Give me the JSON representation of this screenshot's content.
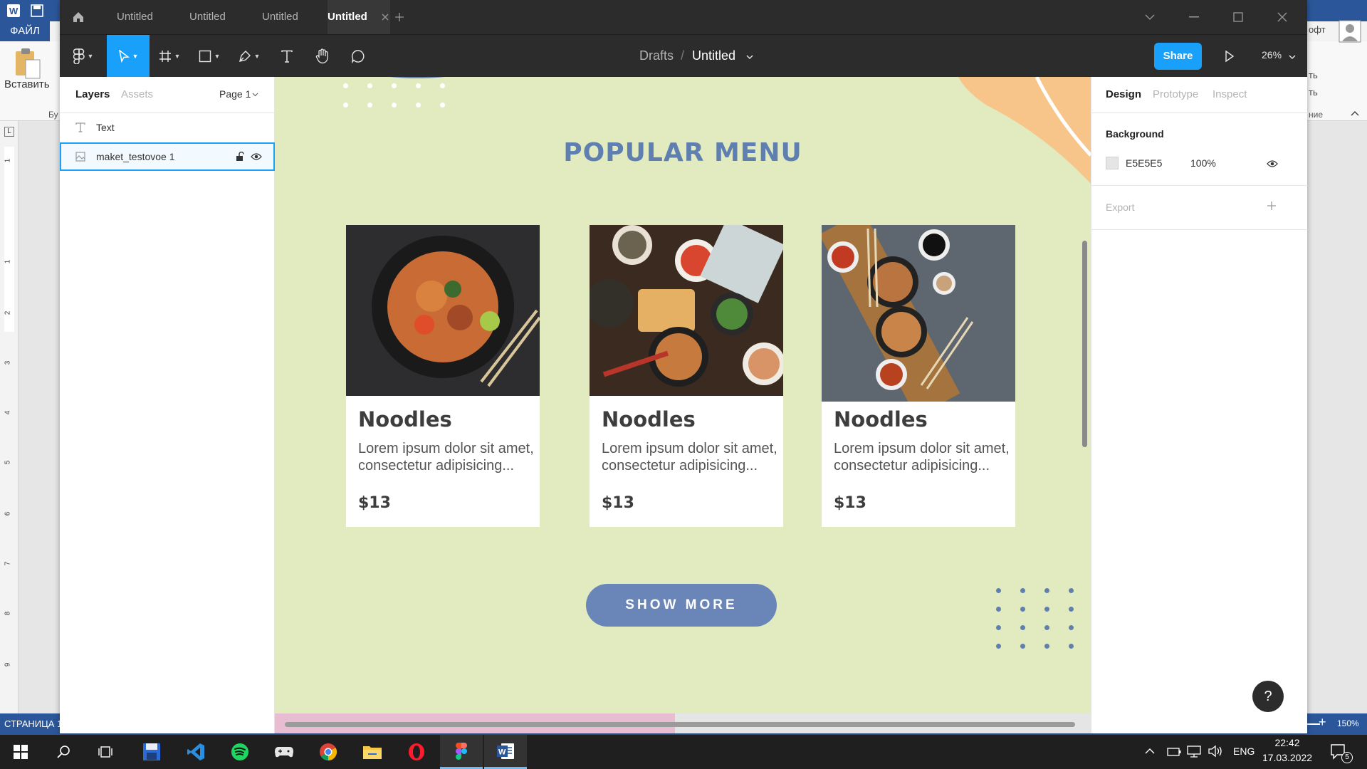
{
  "word": {
    "file_tab": "ФАЙЛ",
    "paste_label": "Вставить",
    "status_page": "СТРАНИЦА 1",
    "zoom": "150%",
    "ribbon_right_1": "офт",
    "ribbon_right_2": "ть",
    "ribbon_right_3": "ть",
    "ribbon_right_4": "ние",
    "ribbon_clip": "Бу",
    "ruler_numbers": [
      "1",
      "1",
      "2",
      "3",
      "4",
      "5",
      "6",
      "7",
      "8",
      "9"
    ]
  },
  "figma": {
    "tabs": [
      {
        "label": "Untitled",
        "active": false
      },
      {
        "label": "Untitled",
        "active": false
      },
      {
        "label": "Untitled",
        "active": false
      },
      {
        "label": "Untitled",
        "active": true
      }
    ],
    "breadcrumb": {
      "parent": "Drafts",
      "separator": "/",
      "file": "Untitled"
    },
    "share_label": "Share",
    "zoom_label": "26%",
    "left_panel": {
      "tab_layers": "Layers",
      "tab_assets": "Assets",
      "page_selector": "Page 1",
      "layers": [
        {
          "name": "Text",
          "icon": "text-icon",
          "selected": false
        },
        {
          "name": "maket_testovoe 1",
          "icon": "image-icon",
          "selected": true
        }
      ]
    },
    "right_panel": {
      "tab_design": "Design",
      "tab_prototype": "Prototype",
      "tab_inspect": "Inspect",
      "background_heading": "Background",
      "background_hex": "E5E5E5",
      "background_opacity": "100%",
      "export_heading": "Export"
    },
    "help_label": "?"
  },
  "design": {
    "heading": "POPULAR MENU",
    "cards": [
      {
        "title": "Noodles",
        "desc": "Lorem ipsum dolor sit amet, consectetur  adipisicing...",
        "price": "$13"
      },
      {
        "title": "Noodles",
        "desc": "Lorem ipsum dolor sit amet, consectetur  adipisicing...",
        "price": "$13"
      },
      {
        "title": "Noodles",
        "desc": "Lorem ipsum dolor sit amet, consectetur  adipisicing...",
        "price": "$13"
      }
    ],
    "button_label": "SHOW MORE",
    "colors": {
      "background": "#e2ebbf",
      "heading": "#5f7fb1",
      "button": "#6a86b8",
      "accent_shape": "#f7c58a"
    }
  },
  "taskbar": {
    "language": "ENG",
    "time": "22:42",
    "date": "17.03.2022",
    "notification_count": "5",
    "apps": [
      "windows-start-icon",
      "search-icon",
      "task-view-icon",
      "floppy-app-icon",
      "vscode-icon",
      "spotify-icon",
      "game-controller-icon",
      "chrome-icon",
      "file-explorer-icon",
      "opera-icon",
      "figma-icon",
      "word-icon"
    ]
  }
}
